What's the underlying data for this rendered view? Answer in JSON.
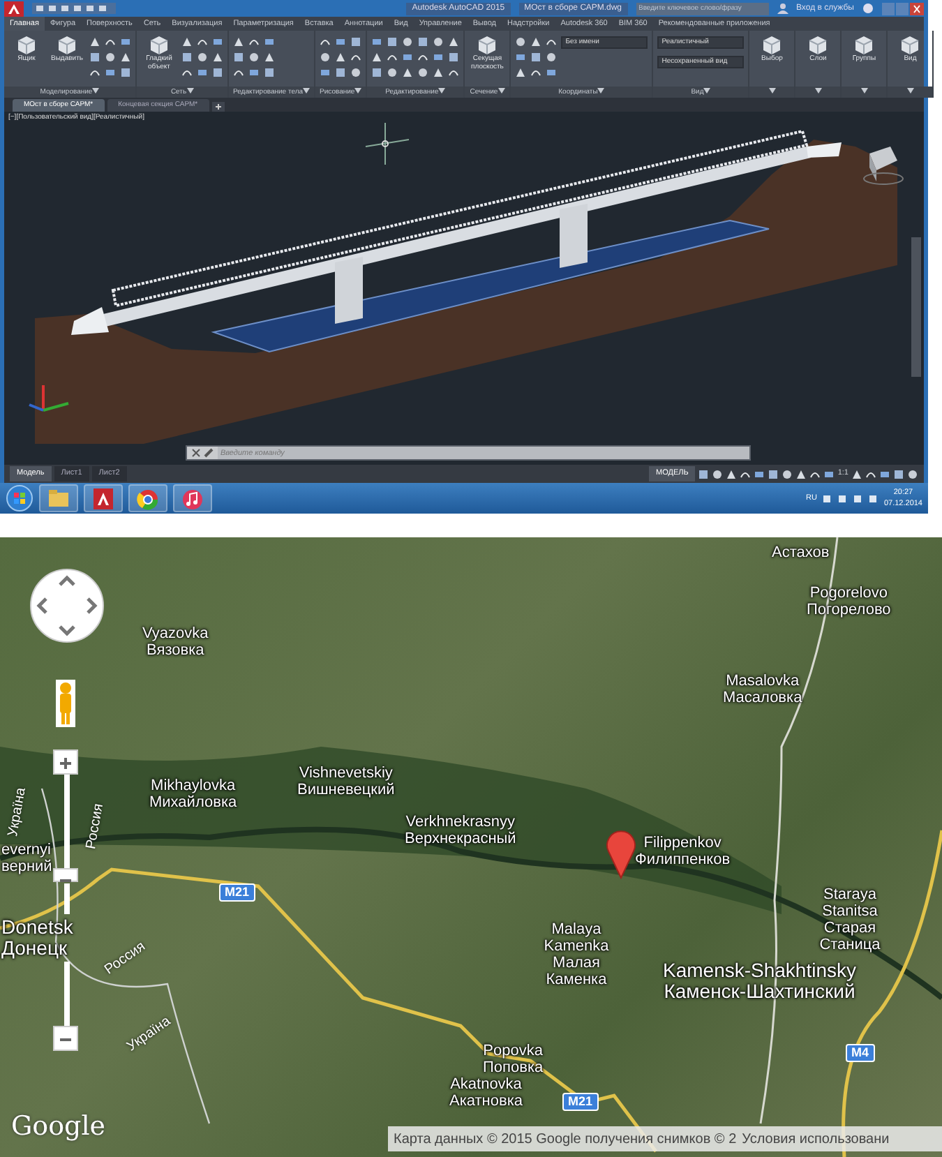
{
  "autocad_window": {
    "title_app": "Autodesk AutoCAD 2015",
    "title_file": "МОст в сборе САРМ.dwg",
    "search": {
      "placeholder": "Введите ключевое слово/фразу"
    },
    "sign_in": "Вход в службы",
    "ribbon_tabs": [
      {
        "label": "Главная",
        "selected": true
      },
      {
        "label": "Фигура",
        "selected": false
      },
      {
        "label": "Поверхность",
        "selected": false
      },
      {
        "label": "Сеть",
        "selected": false
      },
      {
        "label": "Визуализация",
        "selected": false
      },
      {
        "label": "Параметризация",
        "selected": false
      },
      {
        "label": "Вставка",
        "selected": false
      },
      {
        "label": "Аннотации",
        "selected": false
      },
      {
        "label": "Вид",
        "selected": false
      },
      {
        "label": "Управление",
        "selected": false
      },
      {
        "label": "Вывод",
        "selected": false
      },
      {
        "label": "Надстройки",
        "selected": false
      },
      {
        "label": "Autodesk 360",
        "selected": false
      },
      {
        "label": "BIM 360",
        "selected": false
      },
      {
        "label": "Рекомендованные приложения",
        "selected": false
      }
    ],
    "ribbon_panels": [
      {
        "title": "Моделирование",
        "tools": [
          {
            "kind": "large",
            "label": "Ящик"
          },
          {
            "kind": "large",
            "label": "Выдавить"
          },
          {
            "kind": "icons"
          }
        ]
      },
      {
        "title": "Сеть",
        "tools": [
          {
            "kind": "large",
            "label": "Гладкий объект"
          },
          {
            "kind": "icons"
          }
        ]
      },
      {
        "title": "Редактирование тела",
        "tools": [
          {
            "kind": "icons"
          }
        ]
      },
      {
        "title": "Рисование",
        "tools": [
          {
            "kind": "icons"
          }
        ]
      },
      {
        "title": "Редактирование",
        "tools": [
          {
            "kind": "icons"
          },
          {
            "kind": "icons"
          }
        ]
      },
      {
        "title": "Сечение",
        "tools": [
          {
            "kind": "large",
            "label": "Секущая плоскость"
          }
        ]
      },
      {
        "title": "Координаты",
        "tools": [
          {
            "kind": "icons"
          },
          {
            "kind": "dropdown",
            "label": "Без имени"
          }
        ]
      },
      {
        "title": "Вид",
        "tools": [
          {
            "kind": "dropdown",
            "label": "Реалистичный"
          },
          {
            "kind": "dropdown",
            "label": "Несохраненный вид"
          }
        ]
      },
      {
        "tools": [
          {
            "kind": "large",
            "label": "Выбор"
          }
        ]
      },
      {
        "tools": [
          {
            "kind": "large",
            "label": "Слои"
          }
        ]
      },
      {
        "tools": [
          {
            "kind": "large",
            "label": "Группы"
          }
        ]
      },
      {
        "tools": [
          {
            "kind": "large",
            "label": "Вид"
          }
        ]
      }
    ],
    "doc_tabs": [
      {
        "label": "МОст в сборе САРМ*",
        "selected": true
      },
      {
        "label": "Концевая секция САРМ*",
        "selected": false
      }
    ],
    "viewport_label": "[−][Пользовательский вид][Реалистичный]",
    "command_line": {
      "placeholder": "Введите команду"
    },
    "layout_tabs": [
      {
        "label": "Модель",
        "selected": true
      },
      {
        "label": "Лист1",
        "selected": false
      },
      {
        "label": "Лист2",
        "selected": false
      }
    ],
    "status_mode": "МОДЕЛЬ",
    "status_scale": "1:1",
    "taskbar": {
      "language": "RU",
      "time": "20:27",
      "date": "07.12.2014"
    }
  },
  "map": {
    "places": [
      {
        "kind": "village",
        "cyrillic": "Астахов"
      },
      {
        "kind": "village",
        "latin": "Pogorelovo",
        "cyrillic": "Погорелово"
      },
      {
        "kind": "village",
        "latin": "Masalovka",
        "cyrillic": "Масаловка"
      },
      {
        "kind": "village",
        "latin": "Vyazovka",
        "cyrillic": "Вязовка"
      },
      {
        "kind": "village",
        "latin": "Mikhaylovka",
        "cyrillic": "Михайловка"
      },
      {
        "kind": "village",
        "latin": "Vishnevetskiy",
        "cyrillic": "Вишневецкий"
      },
      {
        "kind": "village",
        "latin": "Verkhnekrasnyy",
        "cyrillic": "Верхнекрасный"
      },
      {
        "kind": "village",
        "latin": "Filippenkov",
        "cyrillic": "Филиппенков"
      },
      {
        "kind": "village",
        "latin": "Malaya Kamenka",
        "cyrillic": "Малая Каменка"
      },
      {
        "kind": "village",
        "latin": "Staraya Stanitsa",
        "cyrillic": "Старая Станица"
      },
      {
        "kind": "city",
        "latin": "Kamensk-Shakhtinsky",
        "cyrillic": "Каменск-Шахтинский"
      },
      {
        "kind": "village",
        "latin": "evernyi",
        "cyrillic": "верний"
      },
      {
        "kind": "city",
        "latin": "Donetsk",
        "cyrillic": "Донецк"
      },
      {
        "kind": "village",
        "latin": "Popovka",
        "cyrillic": "Поповка"
      },
      {
        "kind": "village",
        "latin": "Akatnovka",
        "cyrillic": "Акатновка"
      }
    ],
    "borders": [
      "Україна",
      "Россия",
      "Россия",
      "Україна"
    ],
    "road_shields": [
      "M21",
      "M21",
      "M4"
    ],
    "logo": "Google",
    "attribution": "Карта данных © 2015 Google получения снимков © 2",
    "terms": "Условия использовани"
  }
}
